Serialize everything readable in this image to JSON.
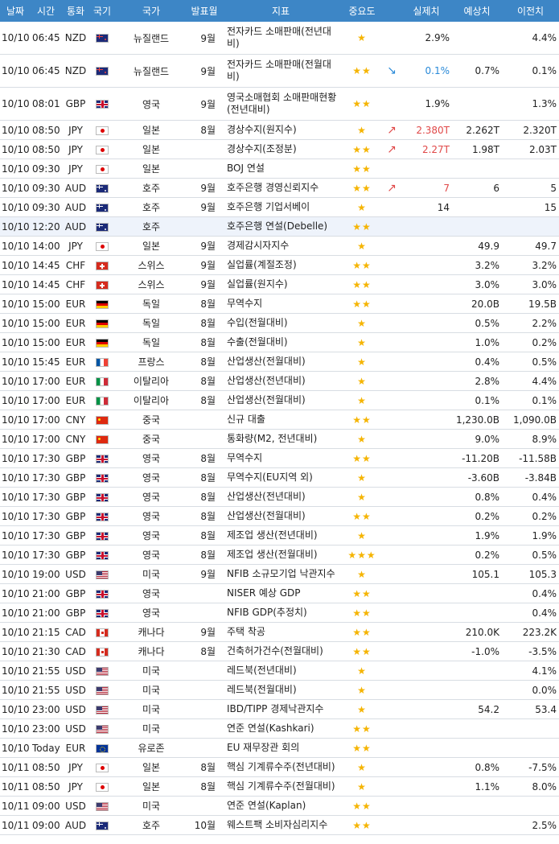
{
  "headers": [
    "날짜",
    "시간",
    "통화",
    "국기",
    "국가",
    "발표월",
    "지표",
    "중요도",
    "",
    "실제치",
    "예상치",
    "이전치"
  ],
  "colors": {
    "header_bg": "#3d86c6",
    "star": "#f5b400",
    "up": "#e04848",
    "down": "#2a8ad8"
  },
  "rows": [
    {
      "date": "10/10",
      "time": "06:45",
      "cur": "NZD",
      "flag": "nz",
      "country": "뉴질랜드",
      "period": "9월",
      "indicator": "전자카드 소매판매(전년대비)",
      "stars": "★",
      "arrow": "",
      "actual": "2.9%",
      "forecast": "",
      "previous": "4.4%",
      "tall": true
    },
    {
      "date": "10/10",
      "time": "06:45",
      "cur": "NZD",
      "flag": "nz",
      "country": "뉴질랜드",
      "period": "9월",
      "indicator": "전자카드 소매판매(전월대비)",
      "stars": "★★",
      "arrow": "↘",
      "dir": "down",
      "actual": "0.1%",
      "forecast": "0.7%",
      "previous": "0.1%",
      "tall": true
    },
    {
      "date": "10/10",
      "time": "08:01",
      "cur": "GBP",
      "flag": "gb",
      "country": "영국",
      "period": "9월",
      "indicator": "영국소매협회 소매판매현황(전년대비)",
      "stars": "★★",
      "arrow": "",
      "actual": "1.9%",
      "forecast": "",
      "previous": "1.3%",
      "tall": true
    },
    {
      "date": "10/10",
      "time": "08:50",
      "cur": "JPY",
      "flag": "jp",
      "country": "일본",
      "period": "8월",
      "indicator": "경상수지(원지수)",
      "stars": "★",
      "arrow": "↗",
      "dir": "up",
      "actual": "2.380T",
      "forecast": "2.262T",
      "previous": "2.320T"
    },
    {
      "date": "10/10",
      "time": "08:50",
      "cur": "JPY",
      "flag": "jp",
      "country": "일본",
      "period": "",
      "indicator": "경상수지(조정분)",
      "stars": "★★",
      "arrow": "↗",
      "dir": "up",
      "actual": "2.27T",
      "forecast": "1.98T",
      "previous": "2.03T"
    },
    {
      "date": "10/10",
      "time": "09:30",
      "cur": "JPY",
      "flag": "jp",
      "country": "일본",
      "period": "",
      "indicator": "BOJ 연설",
      "stars": "★★",
      "arrow": "",
      "actual": "",
      "forecast": "",
      "previous": ""
    },
    {
      "date": "10/10",
      "time": "09:30",
      "cur": "AUD",
      "flag": "au",
      "country": "호주",
      "period": "9월",
      "indicator": "호주은행 경영신뢰지수",
      "stars": "★★",
      "arrow": "↗",
      "dir": "up",
      "actual": "7",
      "forecast": "6",
      "previous": "5"
    },
    {
      "date": "10/10",
      "time": "09:30",
      "cur": "AUD",
      "flag": "au",
      "country": "호주",
      "period": "9월",
      "indicator": "호주은행 기업서베이",
      "stars": "★",
      "arrow": "",
      "actual": "14",
      "forecast": "",
      "previous": "15"
    },
    {
      "date": "10/10",
      "time": "12:20",
      "cur": "AUD",
      "flag": "au",
      "country": "호주",
      "period": "",
      "indicator": "호주은행 연설(Debelle)",
      "stars": "★★",
      "arrow": "",
      "actual": "",
      "forecast": "",
      "previous": "",
      "hl": true
    },
    {
      "date": "10/10",
      "time": "14:00",
      "cur": "JPY",
      "flag": "jp",
      "country": "일본",
      "period": "9월",
      "indicator": "경제감시자지수",
      "stars": "★",
      "arrow": "",
      "actual": "",
      "forecast": "49.9",
      "previous": "49.7"
    },
    {
      "date": "10/10",
      "time": "14:45",
      "cur": "CHF",
      "flag": "ch",
      "country": "스위스",
      "period": "9월",
      "indicator": "실업률(계절조정)",
      "stars": "★★",
      "arrow": "",
      "actual": "",
      "forecast": "3.2%",
      "previous": "3.2%"
    },
    {
      "date": "10/10",
      "time": "14:45",
      "cur": "CHF",
      "flag": "ch",
      "country": "스위스",
      "period": "9월",
      "indicator": "실업률(원지수)",
      "stars": "★★",
      "arrow": "",
      "actual": "",
      "forecast": "3.0%",
      "previous": "3.0%"
    },
    {
      "date": "10/10",
      "time": "15:00",
      "cur": "EUR",
      "flag": "de",
      "country": "독일",
      "period": "8월",
      "indicator": "무역수지",
      "stars": "★★",
      "arrow": "",
      "actual": "",
      "forecast": "20.0B",
      "previous": "19.5B"
    },
    {
      "date": "10/10",
      "time": "15:00",
      "cur": "EUR",
      "flag": "de",
      "country": "독일",
      "period": "8월",
      "indicator": "수입(전월대비)",
      "stars": "★",
      "arrow": "",
      "actual": "",
      "forecast": "0.5%",
      "previous": "2.2%"
    },
    {
      "date": "10/10",
      "time": "15:00",
      "cur": "EUR",
      "flag": "de",
      "country": "독일",
      "period": "8월",
      "indicator": "수출(전월대비)",
      "stars": "★",
      "arrow": "",
      "actual": "",
      "forecast": "1.0%",
      "previous": "0.2%"
    },
    {
      "date": "10/10",
      "time": "15:45",
      "cur": "EUR",
      "flag": "fr",
      "country": "프랑스",
      "period": "8월",
      "indicator": "산업생산(전월대비)",
      "stars": "★",
      "arrow": "",
      "actual": "",
      "forecast": "0.4%",
      "previous": "0.5%"
    },
    {
      "date": "10/10",
      "time": "17:00",
      "cur": "EUR",
      "flag": "it",
      "country": "이탈리아",
      "period": "8월",
      "indicator": "산업생산(전년대비)",
      "stars": "★",
      "arrow": "",
      "actual": "",
      "forecast": "2.8%",
      "previous": "4.4%"
    },
    {
      "date": "10/10",
      "time": "17:00",
      "cur": "EUR",
      "flag": "it",
      "country": "이탈리아",
      "period": "8월",
      "indicator": "산업생산(전월대비)",
      "stars": "★",
      "arrow": "",
      "actual": "",
      "forecast": "0.1%",
      "previous": "0.1%"
    },
    {
      "date": "10/10",
      "time": "17:00",
      "cur": "CNY",
      "flag": "cn",
      "country": "중국",
      "period": "",
      "indicator": "신규 대출",
      "stars": "★★",
      "arrow": "",
      "actual": "",
      "forecast": "1,230.0B",
      "previous": "1,090.0B"
    },
    {
      "date": "10/10",
      "time": "17:00",
      "cur": "CNY",
      "flag": "cn",
      "country": "중국",
      "period": "",
      "indicator": "통화량(M2, 전년대비)",
      "stars": "★",
      "arrow": "",
      "actual": "",
      "forecast": "9.0%",
      "previous": "8.9%"
    },
    {
      "date": "10/10",
      "time": "17:30",
      "cur": "GBP",
      "flag": "gb",
      "country": "영국",
      "period": "8월",
      "indicator": "무역수지",
      "stars": "★★",
      "arrow": "",
      "actual": "",
      "forecast": "-11.20B",
      "previous": "-11.58B"
    },
    {
      "date": "10/10",
      "time": "17:30",
      "cur": "GBP",
      "flag": "gb",
      "country": "영국",
      "period": "8월",
      "indicator": "무역수지(EU지역 외)",
      "stars": "★",
      "arrow": "",
      "actual": "",
      "forecast": "-3.60B",
      "previous": "-3.84B"
    },
    {
      "date": "10/10",
      "time": "17:30",
      "cur": "GBP",
      "flag": "gb",
      "country": "영국",
      "period": "8월",
      "indicator": "산업생산(전년대비)",
      "stars": "★",
      "arrow": "",
      "actual": "",
      "forecast": "0.8%",
      "previous": "0.4%"
    },
    {
      "date": "10/10",
      "time": "17:30",
      "cur": "GBP",
      "flag": "gb",
      "country": "영국",
      "period": "8월",
      "indicator": "산업생산(전월대비)",
      "stars": "★★",
      "arrow": "",
      "actual": "",
      "forecast": "0.2%",
      "previous": "0.2%"
    },
    {
      "date": "10/10",
      "time": "17:30",
      "cur": "GBP",
      "flag": "gb",
      "country": "영국",
      "period": "8월",
      "indicator": "제조업 생산(전년대비)",
      "stars": "★",
      "arrow": "",
      "actual": "",
      "forecast": "1.9%",
      "previous": "1.9%"
    },
    {
      "date": "10/10",
      "time": "17:30",
      "cur": "GBP",
      "flag": "gb",
      "country": "영국",
      "period": "8월",
      "indicator": "제조업 생산(전월대비)",
      "stars": "★★★",
      "arrow": "",
      "actual": "",
      "forecast": "0.2%",
      "previous": "0.5%"
    },
    {
      "date": "10/10",
      "time": "19:00",
      "cur": "USD",
      "flag": "us",
      "country": "미국",
      "period": "9월",
      "indicator": "NFIB 소규모기업 낙관지수",
      "stars": "★",
      "arrow": "",
      "actual": "",
      "forecast": "105.1",
      "previous": "105.3"
    },
    {
      "date": "10/10",
      "time": "21:00",
      "cur": "GBP",
      "flag": "gb",
      "country": "영국",
      "period": "",
      "indicator": "NISER 예상 GDP",
      "stars": "★★",
      "arrow": "",
      "actual": "",
      "forecast": "",
      "previous": "0.4%"
    },
    {
      "date": "10/10",
      "time": "21:00",
      "cur": "GBP",
      "flag": "gb",
      "country": "영국",
      "period": "",
      "indicator": "NFIB GDP(추정치)",
      "stars": "★★",
      "arrow": "",
      "actual": "",
      "forecast": "",
      "previous": "0.4%"
    },
    {
      "date": "10/10",
      "time": "21:15",
      "cur": "CAD",
      "flag": "ca",
      "country": "캐나다",
      "period": "9월",
      "indicator": "주택 착공",
      "stars": "★★",
      "arrow": "",
      "actual": "",
      "forecast": "210.0K",
      "previous": "223.2K"
    },
    {
      "date": "10/10",
      "time": "21:30",
      "cur": "CAD",
      "flag": "ca",
      "country": "캐나다",
      "period": "8월",
      "indicator": "건축허가건수(전월대비)",
      "stars": "★★",
      "arrow": "",
      "actual": "",
      "forecast": "-1.0%",
      "previous": "-3.5%"
    },
    {
      "date": "10/10",
      "time": "21:55",
      "cur": "USD",
      "flag": "us",
      "country": "미국",
      "period": "",
      "indicator": "레드북(전년대비)",
      "stars": "★",
      "arrow": "",
      "actual": "",
      "forecast": "",
      "previous": "4.1%"
    },
    {
      "date": "10/10",
      "time": "21:55",
      "cur": "USD",
      "flag": "us",
      "country": "미국",
      "period": "",
      "indicator": "레드북(전월대비)",
      "stars": "★",
      "arrow": "",
      "actual": "",
      "forecast": "",
      "previous": "0.0%"
    },
    {
      "date": "10/10",
      "time": "23:00",
      "cur": "USD",
      "flag": "us",
      "country": "미국",
      "period": "",
      "indicator": "IBD/TIPP 경제낙관지수",
      "stars": "★",
      "arrow": "",
      "actual": "",
      "forecast": "54.2",
      "previous": "53.4"
    },
    {
      "date": "10/10",
      "time": "23:00",
      "cur": "USD",
      "flag": "us",
      "country": "미국",
      "period": "",
      "indicator": "연준 연설(Kashkari)",
      "stars": "★★",
      "arrow": "",
      "actual": "",
      "forecast": "",
      "previous": ""
    },
    {
      "date": "10/10",
      "time": "Today",
      "cur": "EUR",
      "flag": "eu",
      "country": "유로존",
      "period": "",
      "indicator": "EU 재무장관 회의",
      "stars": "★★",
      "arrow": "",
      "actual": "",
      "forecast": "",
      "previous": ""
    },
    {
      "date": "10/11",
      "time": "08:50",
      "cur": "JPY",
      "flag": "jp",
      "country": "일본",
      "period": "8월",
      "indicator": "핵심 기계류수주(전년대비)",
      "stars": "★",
      "arrow": "",
      "actual": "",
      "forecast": "0.8%",
      "previous": "-7.5%"
    },
    {
      "date": "10/11",
      "time": "08:50",
      "cur": "JPY",
      "flag": "jp",
      "country": "일본",
      "period": "8월",
      "indicator": "핵심 기계류수주(전월대비)",
      "stars": "★",
      "arrow": "",
      "actual": "",
      "forecast": "1.1%",
      "previous": "8.0%"
    },
    {
      "date": "10/11",
      "time": "09:00",
      "cur": "USD",
      "flag": "us",
      "country": "미국",
      "period": "",
      "indicator": "연준 연설(Kaplan)",
      "stars": "★★",
      "arrow": "",
      "actual": "",
      "forecast": "",
      "previous": ""
    },
    {
      "date": "10/11",
      "time": "09:00",
      "cur": "AUD",
      "flag": "au",
      "country": "호주",
      "period": "10월",
      "indicator": "웨스트팩 소비자심리지수",
      "stars": "★★",
      "arrow": "",
      "actual": "",
      "forecast": "",
      "previous": "2.5%"
    }
  ]
}
